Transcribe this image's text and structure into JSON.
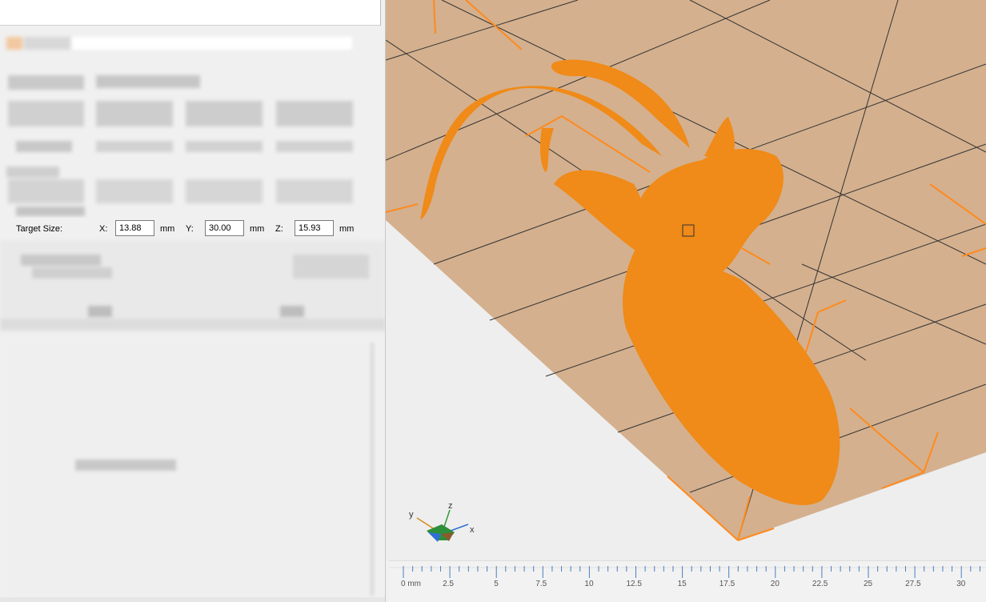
{
  "target_size": {
    "label": "Target Size:",
    "x_label": "X:",
    "x_value": "13.88",
    "y_label": "Y:",
    "y_value": "30.00",
    "z_label": "Z:",
    "z_value": "15.93",
    "unit": "mm"
  },
  "axis_gizmo": {
    "x_label": "x",
    "y_label": "y",
    "z_label": "z"
  },
  "ruler": {
    "labels": [
      "0 mm",
      "2.5",
      "5",
      "7.5",
      "10",
      "12.5",
      "15",
      "17.5",
      "20",
      "22.5",
      "25",
      "27.5",
      "30"
    ]
  },
  "colors": {
    "bed": "#d4b08e",
    "model": "#f08a18",
    "bounding_box": "#ff8a1e",
    "panel": "#f0f0f0"
  }
}
